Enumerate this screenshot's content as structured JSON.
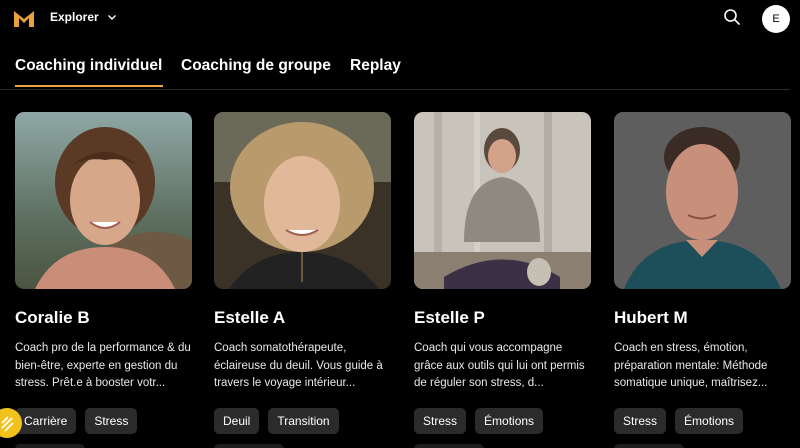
{
  "header": {
    "menu_label": "Explorer",
    "avatar_initial": "E",
    "brand_color": "#e9a040"
  },
  "tabs": [
    {
      "label": "Coaching individuel",
      "active": true
    },
    {
      "label": "Coaching de groupe",
      "active": false
    },
    {
      "label": "Replay",
      "active": false
    }
  ],
  "coaches": [
    {
      "name": "Coralie B",
      "description": "Coach pro de la performance & du bien-être, experte en gestion du stress. Prêt.e à booster votr...",
      "tags": [
        "Carrière",
        "Stress"
      ]
    },
    {
      "name": "Estelle A",
      "description": "Coach somatothérapeute, éclaireuse du deuil. Vous guide à travers le voyage intérieur...",
      "tags": [
        "Deuil",
        "Transition"
      ]
    },
    {
      "name": "Estelle P",
      "description": "Coach qui vous accompagne grâce aux outils qui lui ont permis de réguler son stress, d...",
      "tags": [
        "Stress",
        "Émotions"
      ]
    },
    {
      "name": "Hubert M",
      "description": "Coach en stress, émotion, préparation mentale: Méthode somatique unique, maîtrisez...",
      "tags": [
        "Stress",
        "Émotions"
      ]
    }
  ]
}
